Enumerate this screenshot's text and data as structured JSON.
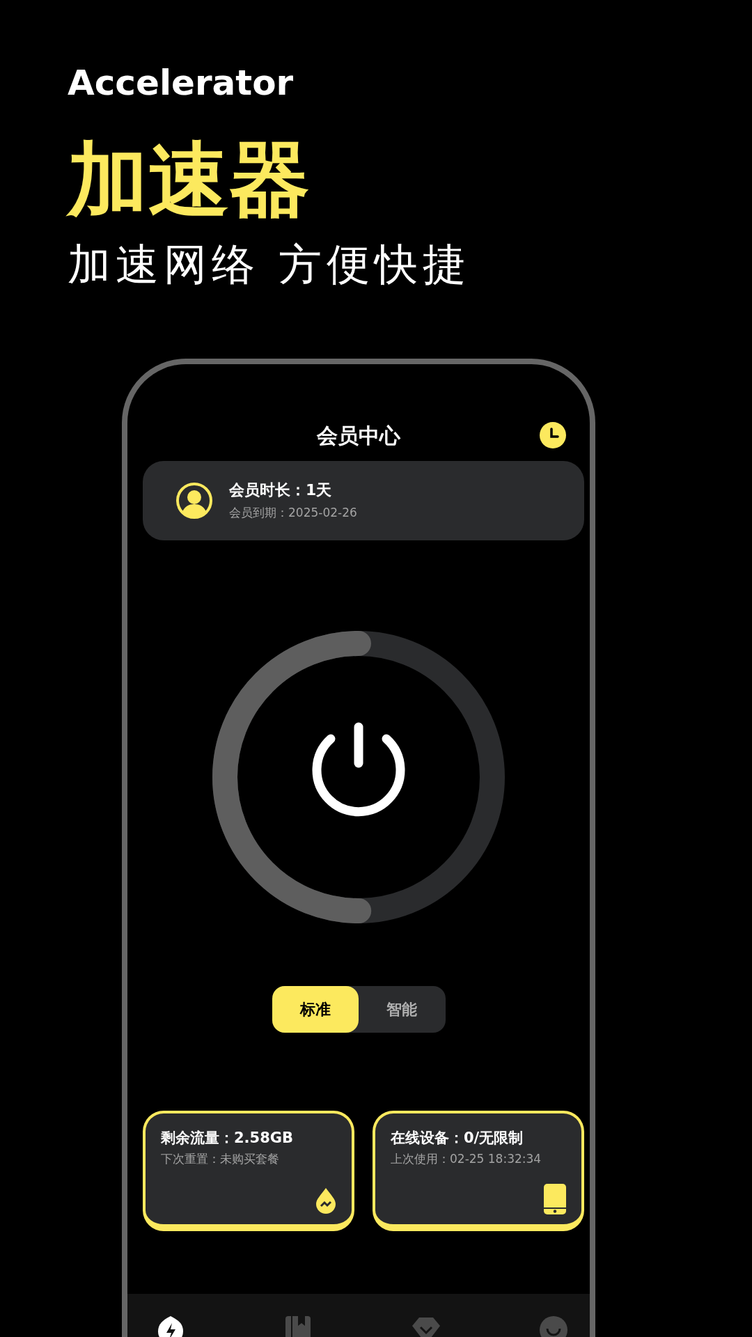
{
  "hero": {
    "subtitle_en": "Accelerator",
    "title": "加速器",
    "tagline": "加速网络 方便快捷"
  },
  "header": {
    "title": "会员中心"
  },
  "member": {
    "duration": "会员时长：1天",
    "expiry": "会员到期：2025-02-26"
  },
  "power": {
    "level": 0.5
  },
  "modes": [
    {
      "label": "标准",
      "selected": true
    },
    {
      "label": "智能",
      "selected": false
    }
  ],
  "stats": [
    {
      "title": "剩余流量：2.58GB",
      "subtitle": "下次重置：未购买套餐"
    },
    {
      "title": "在线设备：0/无限制",
      "subtitle": "上次使用：02-25 18:32:34"
    }
  ],
  "bottom_nav": [
    {
      "selected": true
    },
    {
      "selected": false
    },
    {
      "selected": false
    },
    {
      "selected": false
    }
  ]
}
